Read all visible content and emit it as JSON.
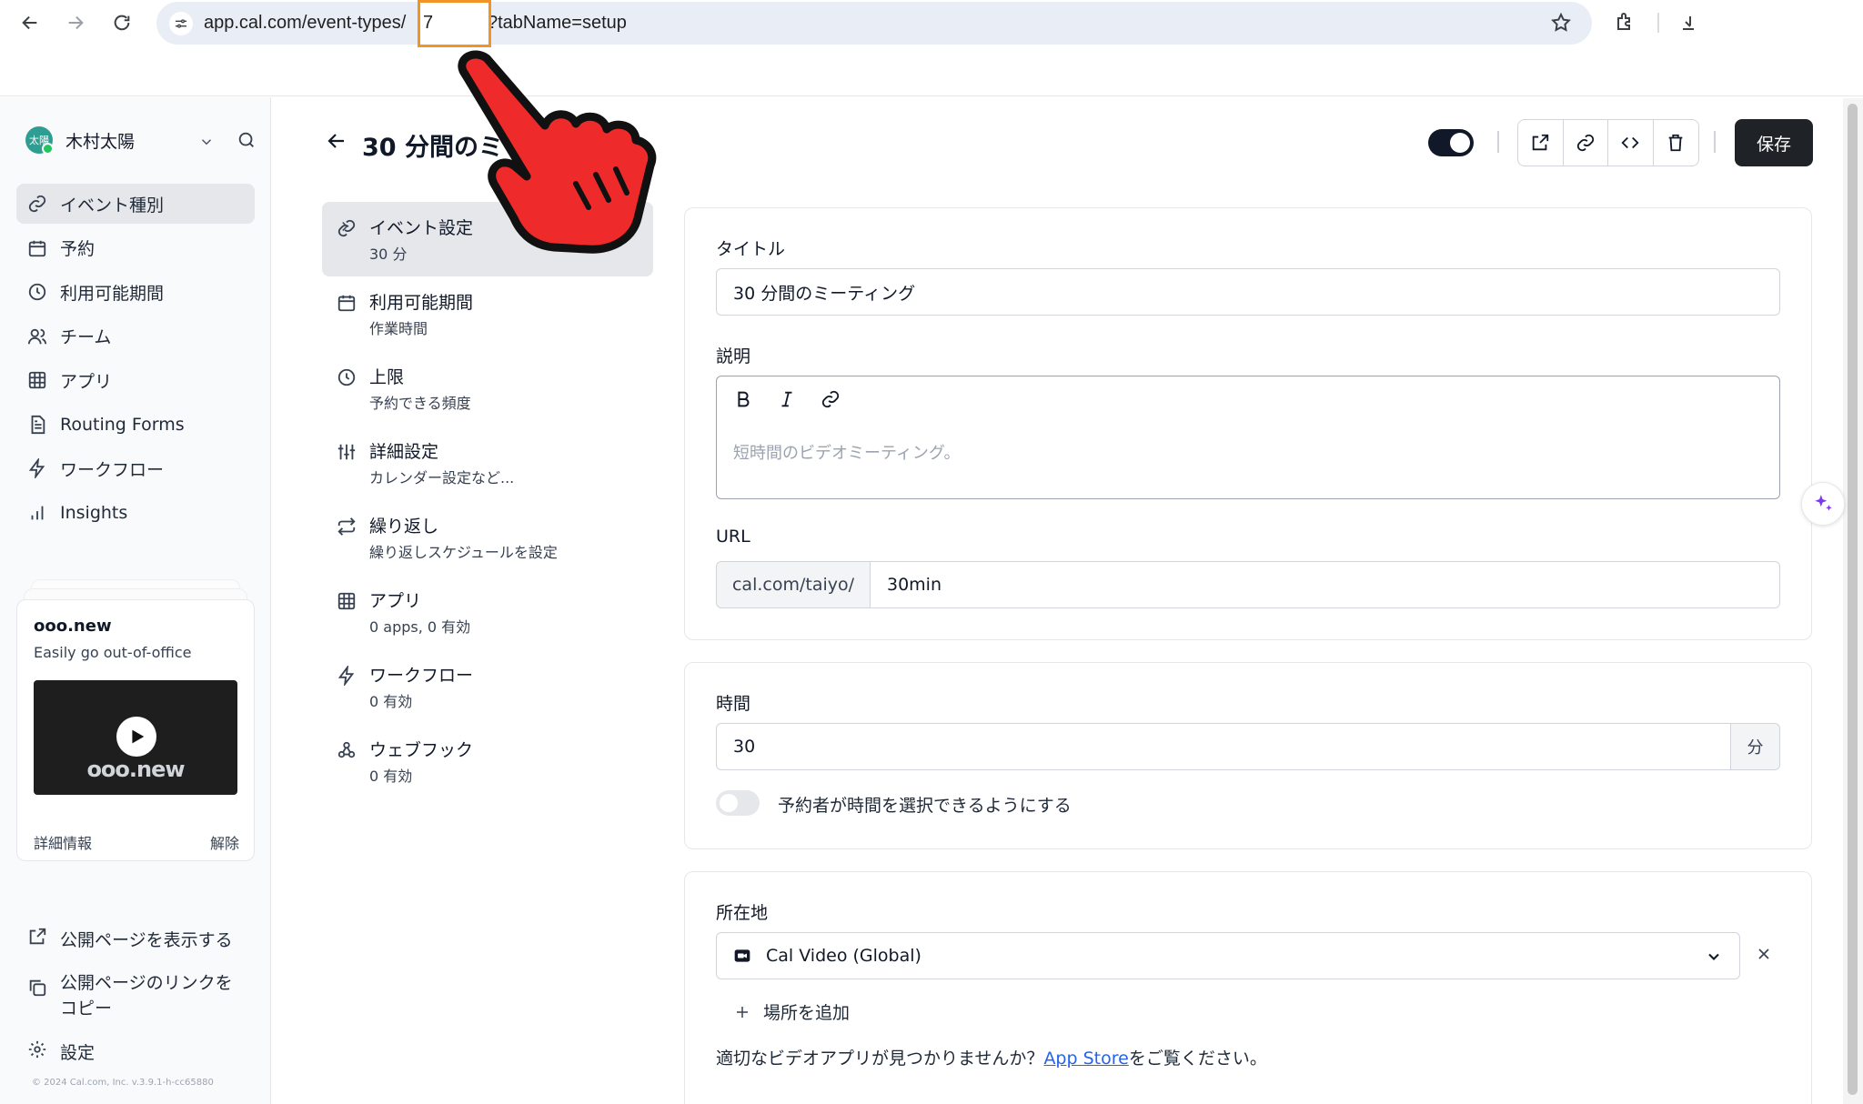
{
  "browser": {
    "url_prefix": "app.cal.com/event-types/",
    "url_highlighted": "7",
    "url_suffix": "?tabName=setup"
  },
  "sidebar": {
    "user_name": "木村太陽",
    "avatar_text": "太陽",
    "items": [
      {
        "label": "イベント種別",
        "icon": "link-icon",
        "active": true
      },
      {
        "label": "予約",
        "icon": "calendar-icon"
      },
      {
        "label": "利用可能期間",
        "icon": "clock-icon"
      },
      {
        "label": "チーム",
        "icon": "users-icon"
      },
      {
        "label": "アプリ",
        "icon": "grid-icon"
      },
      {
        "label": "Routing Forms",
        "icon": "file-icon"
      },
      {
        "label": "ワークフロー",
        "icon": "zap-icon"
      },
      {
        "label": "Insights",
        "icon": "bar-chart-icon"
      }
    ],
    "promo": {
      "title": "ooo.new",
      "subtitle": "Easily go out-of-office",
      "video_logo": "ooo.new",
      "more": "詳細情報",
      "dismiss": "解除"
    },
    "view_public": "公開ページを表示する",
    "copy_public": "公開ページのリンクを\nコピー",
    "settings": "設定",
    "copyright": "© 2024 Cal.com, Inc. v.3.9.1-h-cc65880"
  },
  "header": {
    "title": "30 分間のミ",
    "save_label": "保存"
  },
  "settings_nav": [
    {
      "title": "イベント設定",
      "sub": "30 分",
      "icon": "link-icon",
      "active": true
    },
    {
      "title": "利用可能期間",
      "sub": "作業時間",
      "icon": "calendar-icon"
    },
    {
      "title": "上限",
      "sub": "予約できる頻度",
      "icon": "clock-icon"
    },
    {
      "title": "詳細設定",
      "sub": "カレンダー設定など...",
      "icon": "sliders-icon"
    },
    {
      "title": "繰り返し",
      "sub": "繰り返しスケジュールを設定",
      "icon": "repeat-icon"
    },
    {
      "title": "アプリ",
      "sub": "0 apps, 0 有効",
      "icon": "grid-icon"
    },
    {
      "title": "ワークフロー",
      "sub": "0 有効",
      "icon": "zap-icon"
    },
    {
      "title": "ウェブフック",
      "sub": "0 有効",
      "icon": "webhook-icon"
    }
  ],
  "form": {
    "title_label": "タイトル",
    "title_value": "30 分間のミーティング",
    "description_label": "説明",
    "description_placeholder": "短時間のビデオミーティング。",
    "url_label": "URL",
    "url_prefix": "cal.com/taiyo/",
    "url_slug": "30min",
    "duration_label": "時間",
    "duration_value": "30",
    "duration_unit": "分",
    "duration_toggle_label": "予約者が時間を選択できるようにする",
    "location_label": "所在地",
    "location_value": "Cal Video (Global)",
    "add_location": "場所を追加",
    "note_before": "適切なビデオアプリが見つかりませんか？",
    "note_link": "App Store",
    "note_after": "をご覧ください。"
  },
  "colors": {
    "highlight_box": "#f29325",
    "hand": "#ee2a2a",
    "save_bg": "#1f2328",
    "link": "#2563eb",
    "sparkle": "#7c3aed"
  }
}
